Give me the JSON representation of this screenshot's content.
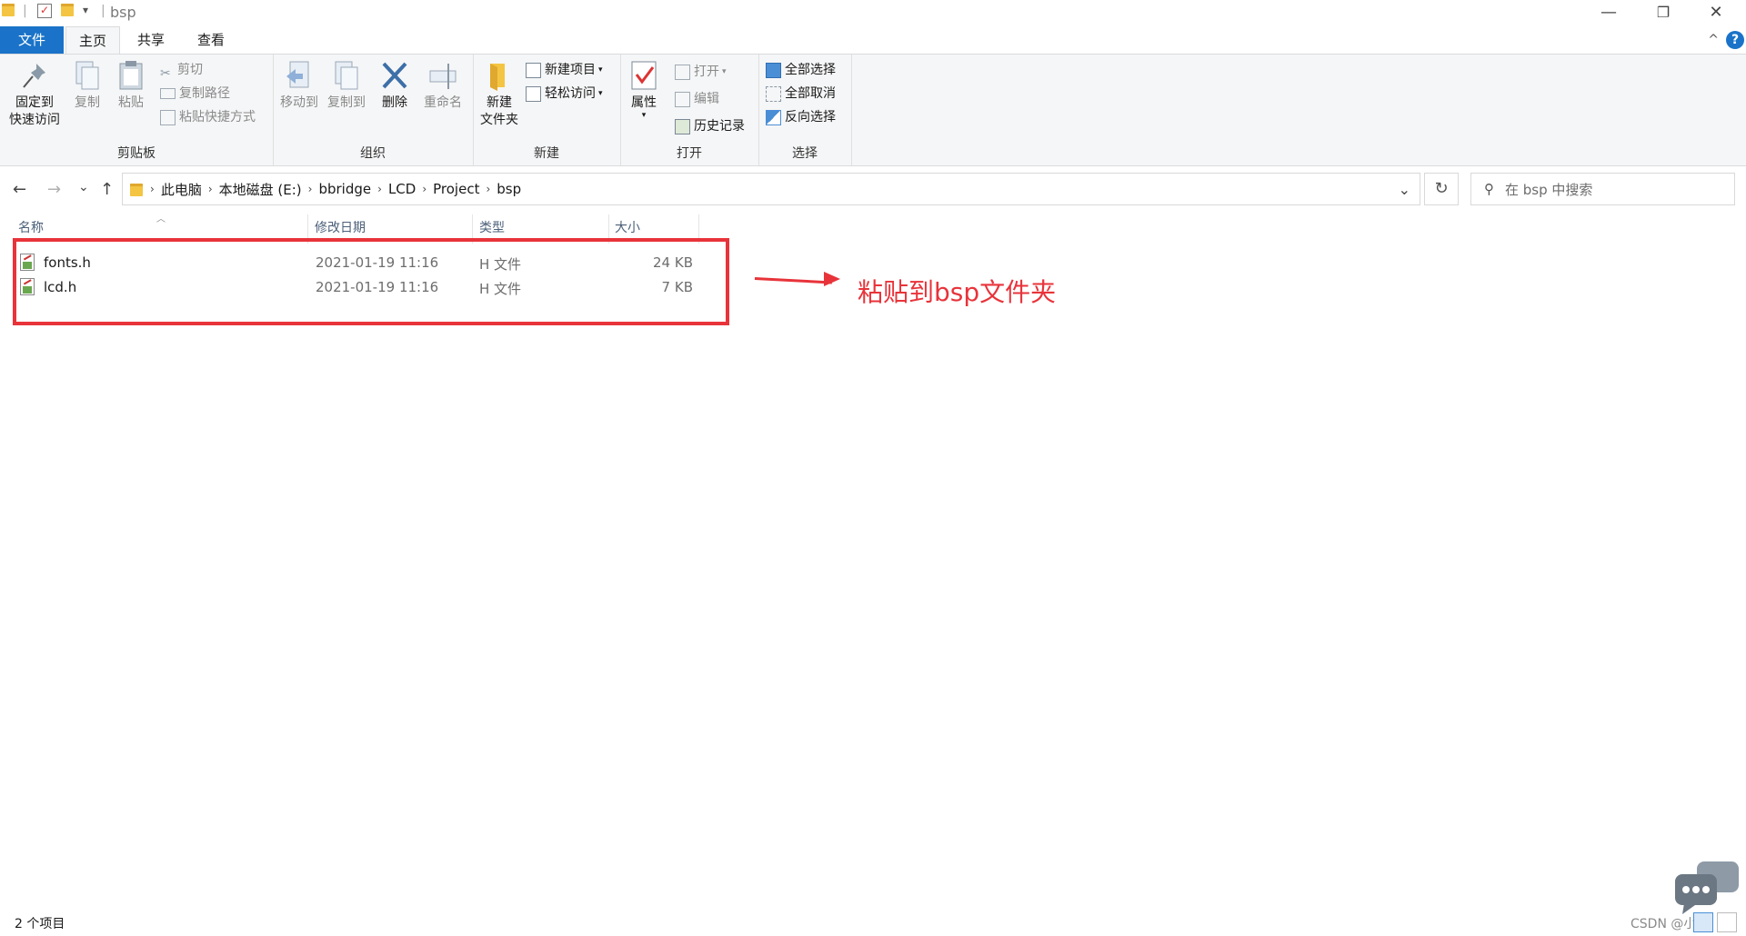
{
  "window": {
    "title": "bsp",
    "qa_more": "▾",
    "minimize": "—",
    "restore": "❐",
    "close": "✕"
  },
  "tabs": [
    {
      "label": "文件"
    },
    {
      "label": "主页"
    },
    {
      "label": "共享"
    },
    {
      "label": "查看"
    }
  ],
  "ribbon": {
    "minimize": "^",
    "help": "?",
    "clipboard": {
      "label": "剪贴板",
      "pin_line1": "固定到",
      "pin_line2": "快速访问",
      "copy": "复制",
      "paste": "粘贴",
      "cut": "剪切",
      "copy_path": "复制路径",
      "paste_shortcut": "粘贴快捷方式"
    },
    "organize": {
      "label": "组织",
      "move_to": "移动到",
      "copy_to": "复制到",
      "delete": "删除",
      "rename": "重命名"
    },
    "new": {
      "label": "新建",
      "new_folder_line1": "新建",
      "new_folder_line2": "文件夹",
      "new_item": "新建项目",
      "easy_access": "轻松访问"
    },
    "open": {
      "label": "打开",
      "properties": "属性",
      "open": "打开",
      "edit": "编辑",
      "history": "历史记录"
    },
    "select": {
      "label": "选择",
      "select_all": "全部选择",
      "select_none": "全部取消",
      "invert": "反向选择"
    }
  },
  "nav": {
    "back": "←",
    "forward": "→",
    "recent": "⌄",
    "up": "↑",
    "crumbs": [
      "此电脑",
      "本地磁盘 (E:)",
      "bbridge",
      "LCD",
      "Project",
      "bsp"
    ],
    "dropdown": "⌄",
    "refresh": "↻",
    "search_placeholder": "在 bsp 中搜索"
  },
  "columns": {
    "name": "名称",
    "date": "修改日期",
    "type": "类型",
    "size": "大小"
  },
  "files": [
    {
      "name": "fonts.h",
      "date": "2021-01-19 11:16",
      "type": "H 文件",
      "size": "24 KB"
    },
    {
      "name": "lcd.h",
      "date": "2021-01-19 11:16",
      "type": "H 文件",
      "size": "7 KB"
    }
  ],
  "annotation": "粘贴到bsp文件夹",
  "status": "2 个项目",
  "watermark": "CSDN @小花"
}
